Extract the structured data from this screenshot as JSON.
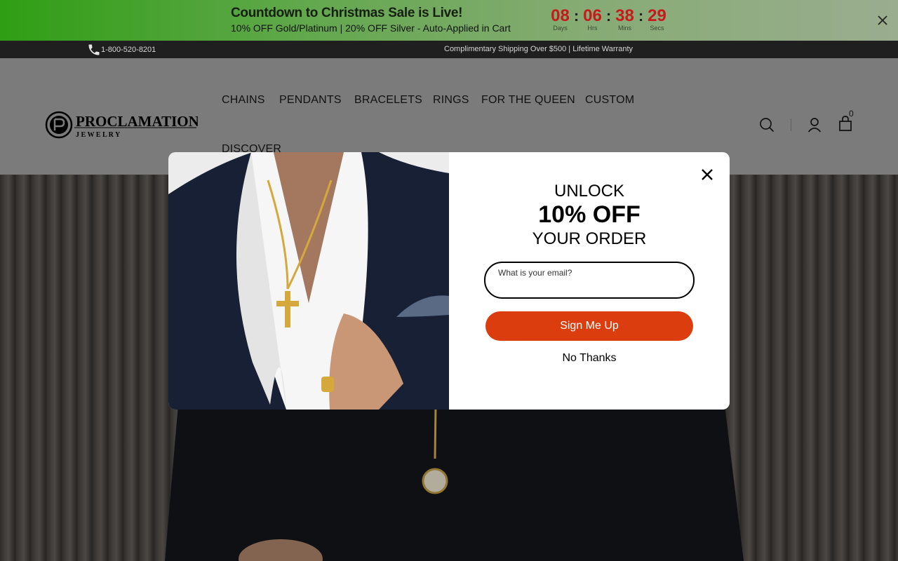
{
  "promo": {
    "title": "Countdown to Christmas Sale is Live!",
    "subtitle": "10% OFF Gold/Platinum | 20% OFF Silver - Auto-Applied in Cart",
    "countdown": [
      {
        "value": "08",
        "label": "Days"
      },
      {
        "value": "06",
        "label": "Hrs"
      },
      {
        "value": "38",
        "label": "Mins"
      },
      {
        "value": "29",
        "label": "Secs"
      }
    ],
    "separator": ":",
    "close_icon": "close-icon"
  },
  "utility": {
    "phone": "1-800-520-8201",
    "shipping": "Complimentary Shipping Over $500 | Lifetime Warranty"
  },
  "header": {
    "logo_line1": "PROCLAMATION",
    "logo_line2": "J E W E L R Y",
    "nav": [
      "CHAINS",
      "PENDANTS",
      "BRACELETS",
      "RINGS",
      "FOR THE QUEEN",
      "CUSTOM",
      "DISCOVER"
    ],
    "cart_count": "0",
    "icons": [
      "search-icon",
      "account-icon",
      "cart-icon"
    ]
  },
  "modal": {
    "headline_top": "UNLOCK",
    "headline_offer": "10% OFF",
    "headline_bottom": "YOUR ORDER",
    "email_label": "What is your email?",
    "email_value": "",
    "signup_label": "Sign Me Up",
    "decline_label": "No Thanks"
  },
  "colors": {
    "promo_start": "#2f9e14",
    "countdown_digits": "#c81a1a",
    "utility_bg": "#1f1f1f",
    "signup_button": "#db3d0e"
  }
}
